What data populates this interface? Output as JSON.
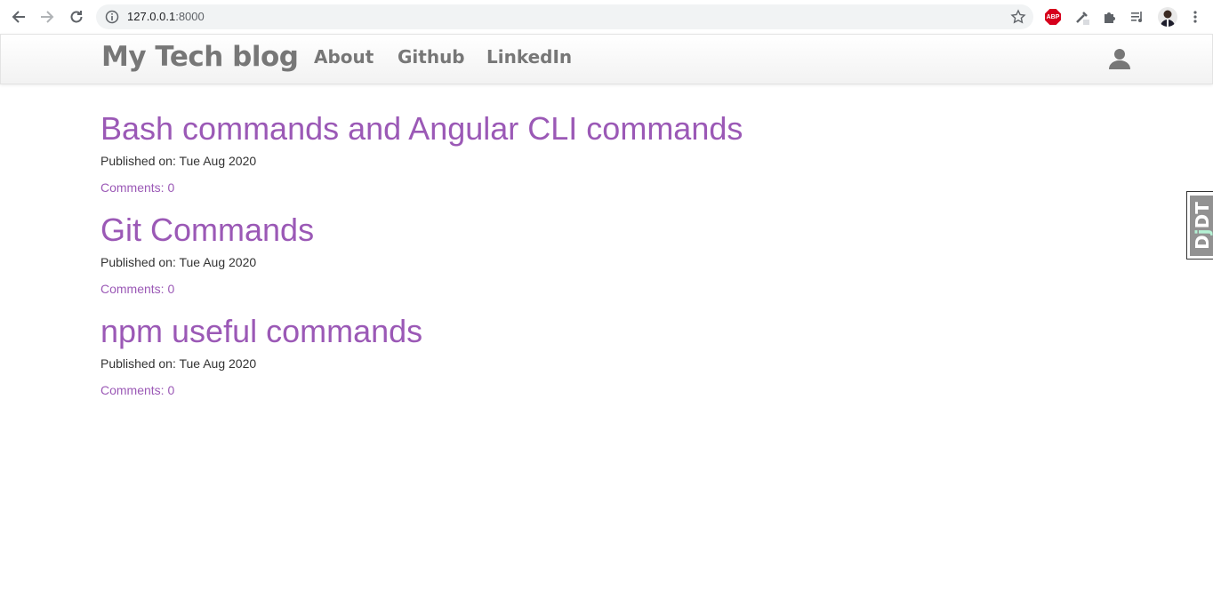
{
  "browser": {
    "url_host": "127.0.0.1",
    "url_port": ":8000"
  },
  "navbar": {
    "brand": "My Tech blog",
    "links": [
      "About",
      "Github",
      "LinkedIn"
    ]
  },
  "posts": [
    {
      "title": "Bash commands and Angular CLI commands",
      "published": "Published on: Tue Aug 2020",
      "comments": "Comments: 0"
    },
    {
      "title": "Git Commands",
      "published": "Published on: Tue Aug 2020",
      "comments": "Comments: 0"
    },
    {
      "title": "npm useful commands",
      "published": "Published on: Tue Aug 2020",
      "comments": "Comments: 0"
    }
  ],
  "extensions": {
    "abp_label": "ABP"
  },
  "djdt": {
    "d1": "D",
    "j": "j",
    "dt": "DT"
  },
  "colors": {
    "accent": "#9b59b6",
    "navtext": "#777777"
  }
}
